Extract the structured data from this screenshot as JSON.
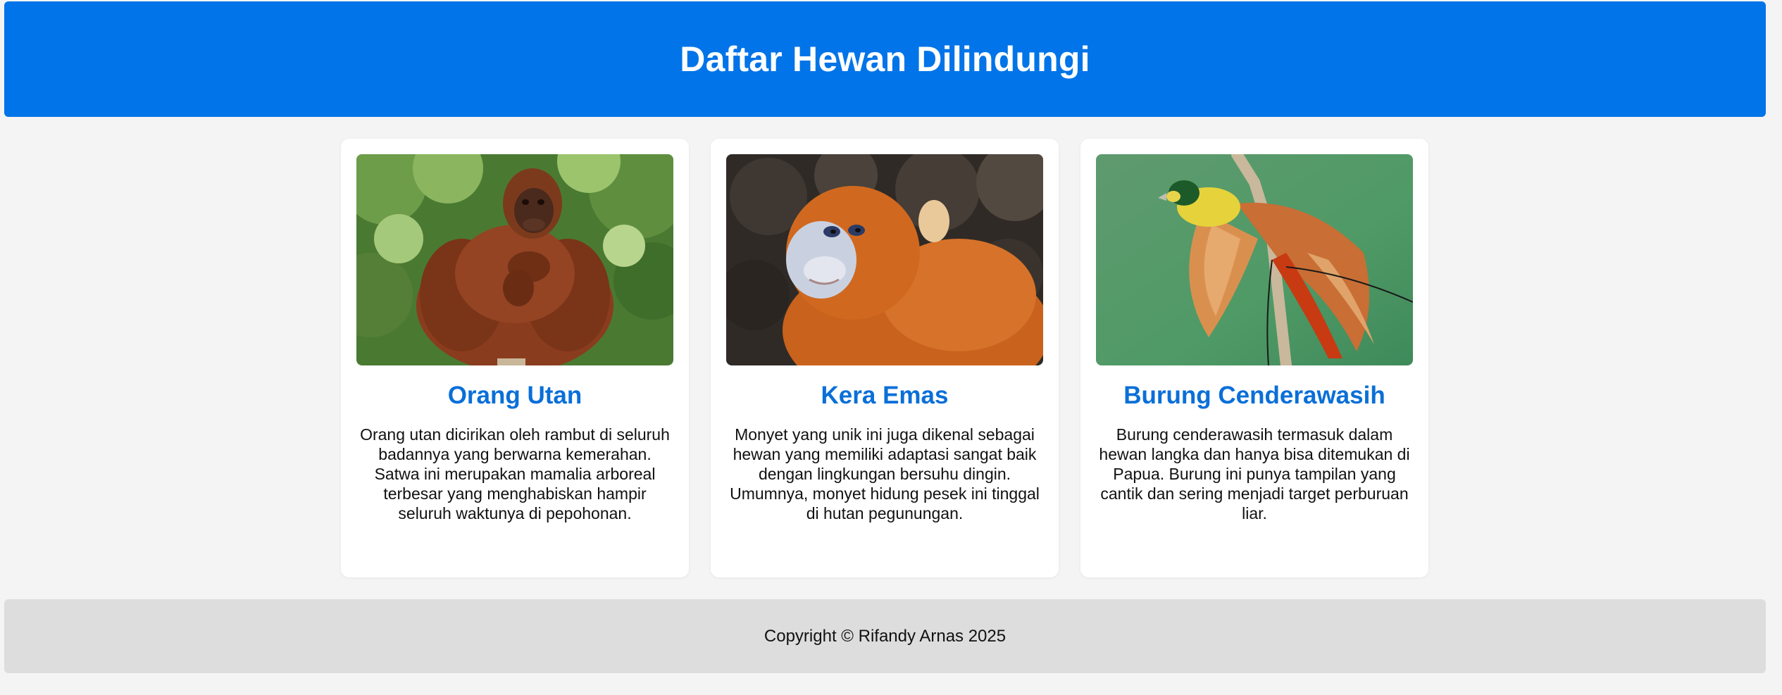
{
  "header": {
    "title": "Daftar Hewan Dilindungi"
  },
  "cards": [
    {
      "title": "Orang Utan",
      "description": "Orang utan dicirikan oleh rambut di seluruh badannya yang berwarna kemerahan. Satwa ini merupakan mamalia arboreal terbesar yang menghabiskan hampir seluruh waktunya di pepohonan."
    },
    {
      "title": "Kera Emas",
      "description": "Monyet yang unik ini juga dikenal sebagai hewan yang memiliki adaptasi sangat baik dengan lingkungan bersuhu dingin. Umumnya, monyet hidung pesek ini tinggal di hutan pegunungan."
    },
    {
      "title": "Burung Cenderawasih",
      "description": "Burung cenderawasih termasuk dalam hewan langka dan hanya bisa ditemukan di Papua. Burung ini punya tampilan yang cantik dan sering menjadi target perburuan liar."
    }
  ],
  "footer": {
    "copyright": "Copyright © Rifandy Arnas 2025"
  },
  "colors": {
    "header_bg": "#0074e8",
    "card_title": "#0a6fd8",
    "page_bg": "#f4f4f4",
    "footer_bg": "#dddddd"
  }
}
